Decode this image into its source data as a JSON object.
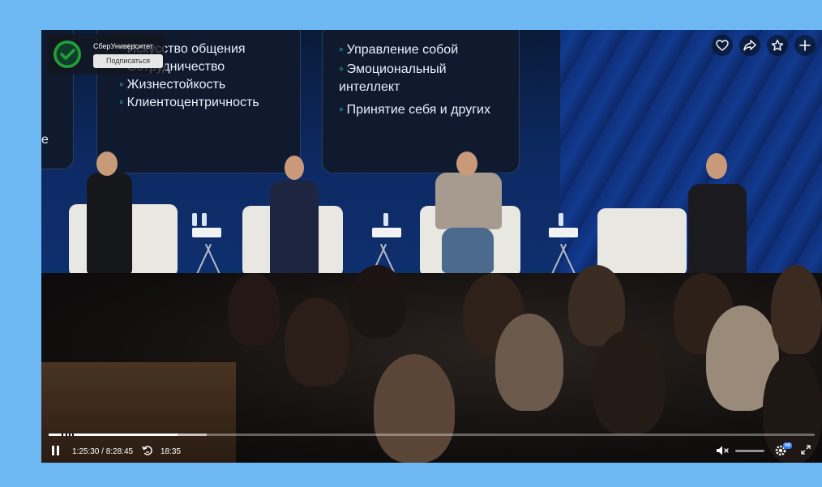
{
  "channel": {
    "name": "СберУниверситет",
    "subscribe_label": "Подписаться"
  },
  "slide": {
    "left_items": [
      "Искусство общения",
      "Сотрудничество",
      "Жизнестойкость",
      "Клиентоцентричность"
    ],
    "right_items": [
      "Управление собой",
      "Эмоциональный интеллект",
      "Принятие себя и других"
    ]
  },
  "top_actions": [
    "heart-icon",
    "share-icon",
    "star-icon",
    "plus-icon"
  ],
  "player": {
    "current_time": "1:25:30",
    "duration": "8:28:45",
    "time_separator": "/",
    "replay_time": "18:35",
    "progress": 0.168,
    "buffered": 0.038,
    "volume_muted": true,
    "quality_badge": "HD"
  },
  "colors": {
    "frame": "#6db8f2",
    "accent": "#2f7cf6",
    "slide_bullet": "#36c7e5"
  }
}
